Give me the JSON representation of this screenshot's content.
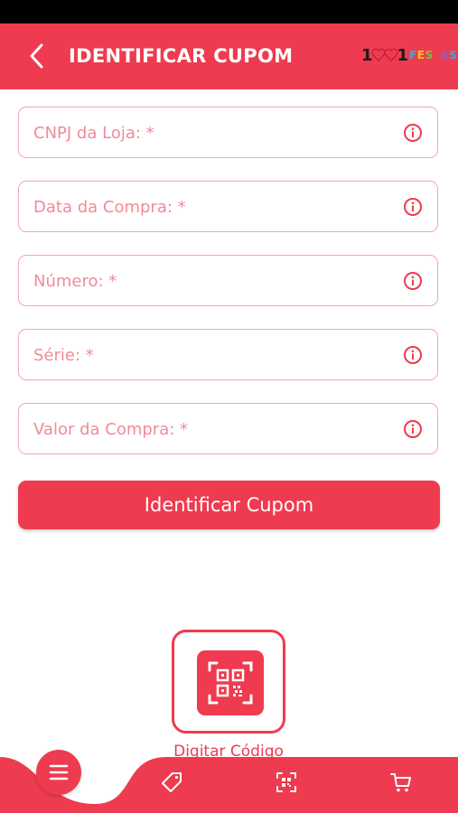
{
  "header": {
    "title": "IDENTIFICAR CUPOM",
    "logo_number": "1001",
    "logo_word": "FESTAS"
  },
  "form": {
    "fields": [
      {
        "placeholder": "CNPJ da Loja: *",
        "value": ""
      },
      {
        "placeholder": "Data da Compra: *",
        "value": ""
      },
      {
        "placeholder": "Número: *",
        "value": ""
      },
      {
        "placeholder": "Série: *",
        "value": ""
      },
      {
        "placeholder": "Valor da Compra: *",
        "value": ""
      }
    ],
    "submit_label": "Identificar Cupom"
  },
  "qr": {
    "label": "Digitar Código",
    "icon": "qr-code-icon"
  },
  "bottom_nav": {
    "items": [
      "menu-icon",
      "tag-icon",
      "qr-scan-icon",
      "cart-icon"
    ]
  },
  "colors": {
    "accent": "#ee3b4f",
    "field_border": "#f2a7b1",
    "placeholder": "#f28a99"
  }
}
